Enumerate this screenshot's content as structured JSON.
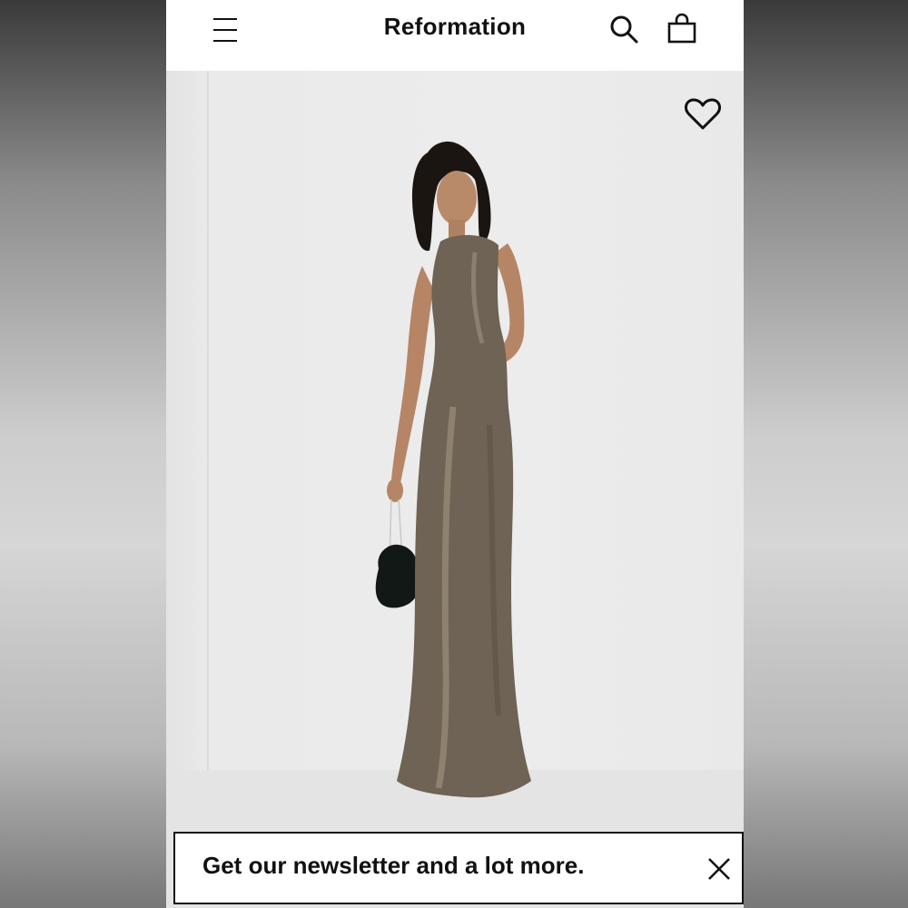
{
  "header": {
    "brand": "Reformation",
    "menu_icon": "hamburger-menu-icon",
    "search_icon": "search-icon",
    "bag_icon": "shopping-bag-icon"
  },
  "hero": {
    "favorite_icon": "heart-icon",
    "image_description_icon": "product-photo"
  },
  "newsletter": {
    "text": "Get our newsletter and a lot more.",
    "close_icon": "close-icon"
  },
  "colors": {
    "text": "#111111",
    "background": "#ffffff",
    "dress": "#6e6354"
  }
}
